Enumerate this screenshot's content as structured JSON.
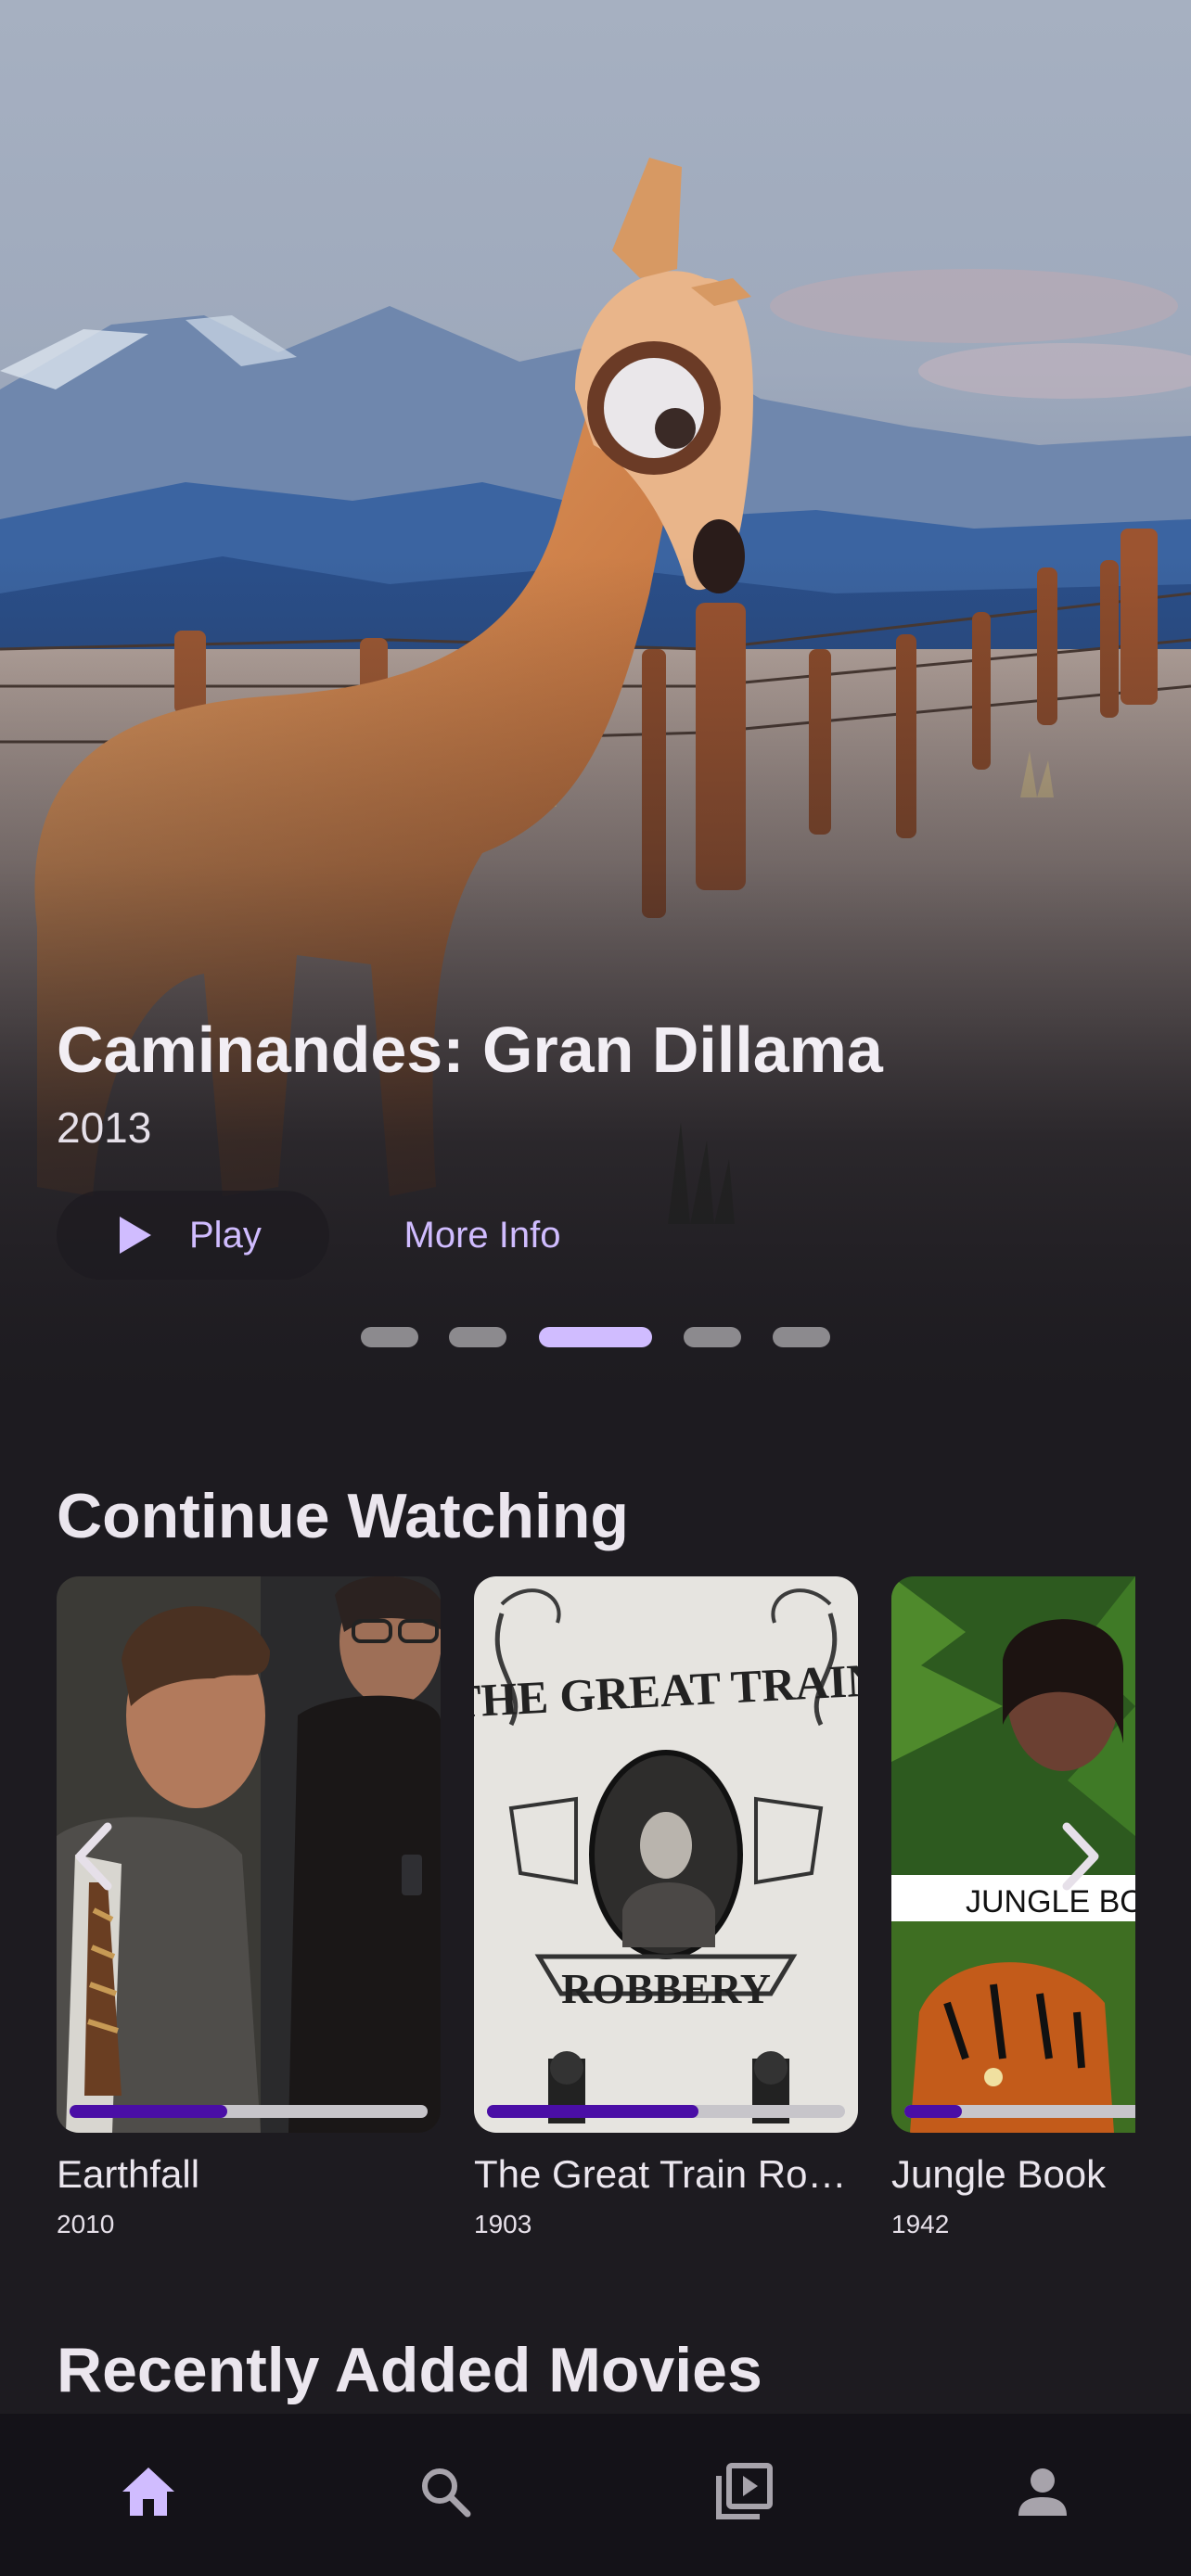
{
  "hero": {
    "title": "Caminandes: Gran Dillama",
    "year": "2013",
    "play_label": "Play",
    "more_info_label": "More Info",
    "carousel_count": 5,
    "carousel_active_index": 2
  },
  "continue_watching": {
    "title": "Continue Watching",
    "items": [
      {
        "name": "Earthfall",
        "year": "2010",
        "progress": 0.44
      },
      {
        "name": "The Great Train Rob…",
        "year": "1903",
        "progress": 0.59
      },
      {
        "name": "Jungle Book",
        "year": "1942",
        "progress": 0.25,
        "poster_text": "JUNGLE BO"
      }
    ],
    "poster_text_train_top": "THE GREAT TRAIN",
    "poster_text_train_bottom": "ROBBERY"
  },
  "recently_added": {
    "title": "Recently Added Movies"
  },
  "bottom_nav": {
    "items": [
      {
        "icon": "home-icon",
        "active": true
      },
      {
        "icon": "search-icon",
        "active": false
      },
      {
        "icon": "library-icon",
        "active": false
      },
      {
        "icon": "profile-icon",
        "active": false
      }
    ]
  },
  "colors": {
    "background": "#1d1b20",
    "accent": "#d0bcff",
    "progress_fill": "#4a0ea6",
    "progress_track": "#c7c5ca",
    "nav_background": "#141218"
  }
}
